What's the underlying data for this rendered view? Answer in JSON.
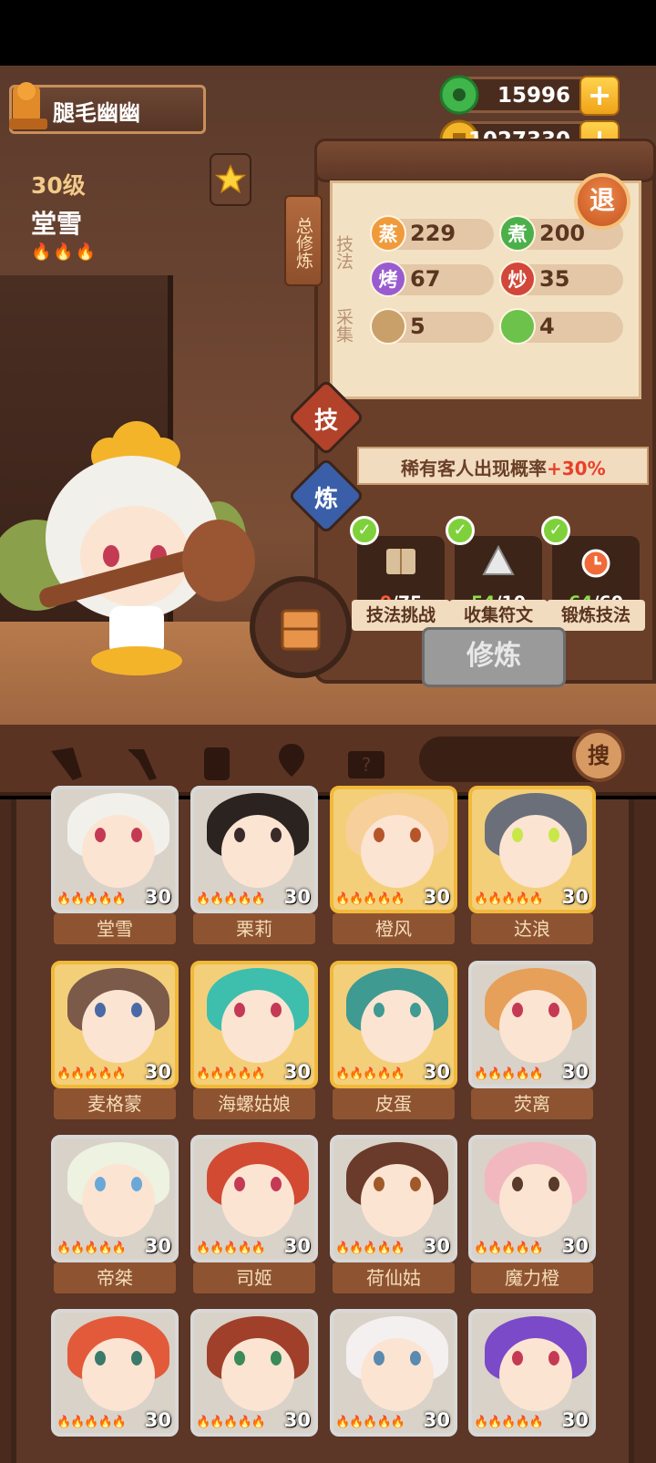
{
  "player": {
    "name": "腿毛幽幽"
  },
  "character": {
    "level": "30级",
    "name": "堂雪"
  },
  "currency": [
    {
      "icon": "jade-coin-icon",
      "value": "15996"
    },
    {
      "icon": "gold-coin-icon",
      "value": "1027330"
    }
  ],
  "board": {
    "total_label": "总修炼",
    "technique_label": "技法",
    "gather_label": "采集",
    "exit_label": "退",
    "stats": [
      {
        "icon_text": "蒸",
        "value": "229",
        "color": "#f09a3a"
      },
      {
        "icon_text": "煮",
        "value": "200",
        "color": "#4bb04a"
      },
      {
        "icon_text": "烤",
        "value": "67",
        "color": "#9a5bd0"
      },
      {
        "icon_text": "炒",
        "value": "35",
        "color": "#d2473a"
      },
      {
        "icon_text": "",
        "value": "5",
        "color": "#caa06a"
      },
      {
        "icon_text": "",
        "value": "4",
        "color": "#6cc24a"
      }
    ]
  },
  "tabs": {
    "skill": "技",
    "refine": "炼"
  },
  "bonus": {
    "text": "稀有客人出现概率",
    "percent": "+30%"
  },
  "tasks": [
    {
      "current": "0",
      "total": "/75",
      "label": "技法挑战",
      "current_color": "#ff5a3a"
    },
    {
      "current": "54",
      "total": "/10",
      "label": "收集符文",
      "current_color": "#8be04a"
    },
    {
      "current": "64",
      "total": "/60",
      "label": "锻炼技法",
      "current_color": "#8be04a"
    }
  ],
  "cultivate_button": "修炼",
  "search_button": "搜",
  "cards": [
    {
      "name": "堂雪",
      "level": "30",
      "frame": "silver",
      "hair": "#f2f0ea",
      "eye": "#c43a55"
    },
    {
      "name": "栗莉",
      "level": "30",
      "frame": "silver",
      "hair": "#2b2320",
      "eye": "#3a2a2a"
    },
    {
      "name": "橙风",
      "level": "30",
      "frame": "gold",
      "hair": "#f6cf9a",
      "eye": "#b5562a"
    },
    {
      "name": "达浪",
      "level": "30",
      "frame": "gold",
      "hair": "#6a6f7a",
      "eye": "#c8e84a"
    },
    {
      "name": "麦格蒙",
      "level": "30",
      "frame": "gold",
      "hair": "#7b5a4a",
      "eye": "#4a6aa6"
    },
    {
      "name": "海螺姑娘",
      "level": "30",
      "frame": "gold",
      "hair": "#3ebfae",
      "eye": "#c43a55"
    },
    {
      "name": "皮蛋",
      "level": "30",
      "frame": "gold",
      "hair": "#3f9a92",
      "eye": "#3f9a92"
    },
    {
      "name": "荧离",
      "level": "30",
      "frame": "silver",
      "hair": "#e7a05a",
      "eye": "#c43a55"
    },
    {
      "name": "帝桀",
      "level": "30",
      "frame": "silver",
      "hair": "#eef2e0",
      "eye": "#6aa8d8"
    },
    {
      "name": "司姬",
      "level": "30",
      "frame": "silver",
      "hair": "#d24a32",
      "eye": "#c43a55"
    },
    {
      "name": "荷仙姑",
      "level": "30",
      "frame": "silver",
      "hair": "#6a3a2a",
      "eye": "#a05a2a"
    },
    {
      "name": "魔力橙",
      "level": "30",
      "frame": "silver",
      "hair": "#f2b8c0",
      "eye": "#5a3a2a"
    },
    {
      "name": "",
      "level": "30",
      "frame": "silver",
      "hair": "#e35a3a",
      "eye": "#3a7a6a"
    },
    {
      "name": "",
      "level": "30",
      "frame": "silver",
      "hair": "#a0402a",
      "eye": "#3a8a5a"
    },
    {
      "name": "",
      "level": "30",
      "frame": "silver",
      "hair": "#f4f0f0",
      "eye": "#5a8ab0"
    },
    {
      "name": "",
      "level": "30",
      "frame": "silver",
      "hair": "#7a4ac8",
      "eye": "#c43a55"
    }
  ]
}
